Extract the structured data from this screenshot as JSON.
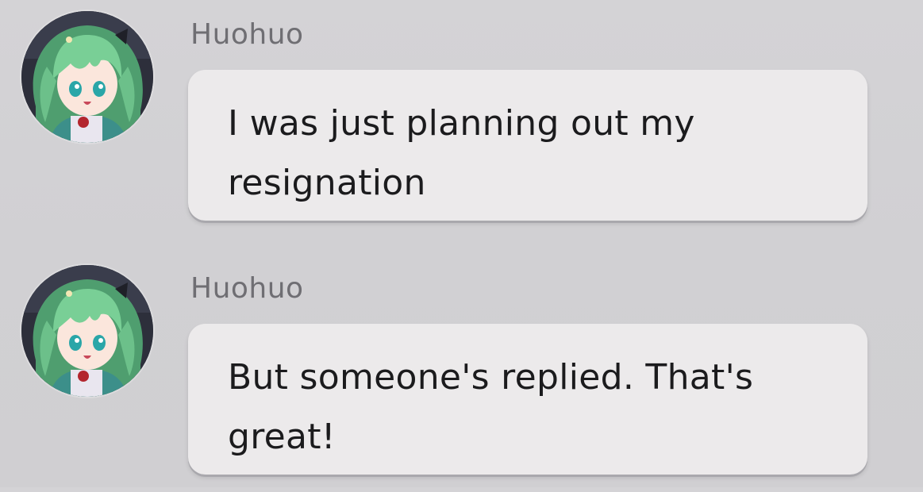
{
  "messages": [
    {
      "sender": "Huohuo",
      "text": "I was just planning out my resignation",
      "avatar_icon": "huohuo-avatar"
    },
    {
      "sender": "Huohuo",
      "text": "But someone's replied. That's great!",
      "avatar_icon": "huohuo-avatar"
    }
  ],
  "colors": {
    "background": "#d3d2d5",
    "bubble": "#eceaeb",
    "sender_text": "#6f6e73",
    "message_text": "#1b1b1d",
    "avatar_hair": "#6fc28d"
  }
}
